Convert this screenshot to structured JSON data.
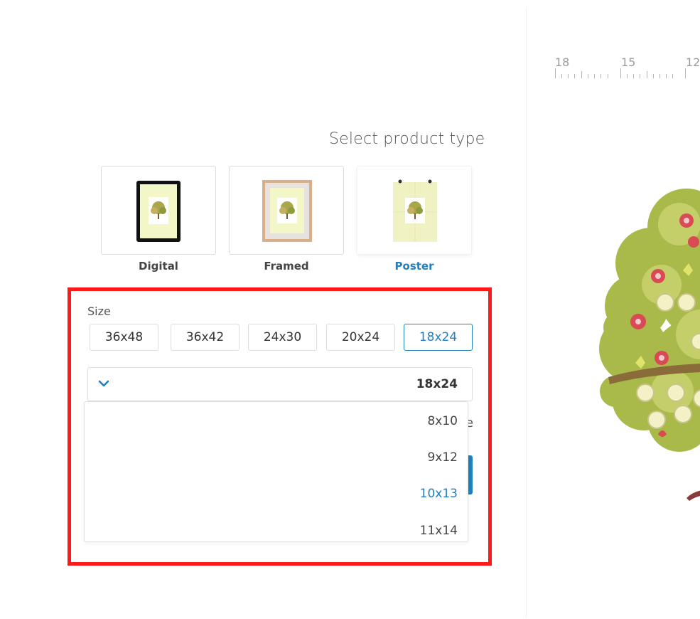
{
  "preview": {
    "ruler_labels": [
      "18",
      "15",
      "12"
    ]
  },
  "product_type": {
    "title": "Select product type",
    "options": [
      {
        "label": "Digital",
        "icon": "tablet-icon",
        "selected": false
      },
      {
        "label": "Framed",
        "icon": "framed-print-icon",
        "selected": false
      },
      {
        "label": "Poster",
        "icon": "poster-icon",
        "selected": true
      }
    ]
  },
  "size": {
    "label": "Size",
    "buttons": [
      {
        "label": "36x48",
        "selected": false
      },
      {
        "label": "36x42",
        "selected": false
      },
      {
        "label": "24x30",
        "selected": false
      },
      {
        "label": "20x24",
        "selected": false
      },
      {
        "label": "18x24",
        "selected": true
      }
    ],
    "select_value": "18x24",
    "dropdown_options": [
      {
        "label": "8x10",
        "highlighted": false
      },
      {
        "label": "9x12",
        "highlighted": false
      },
      {
        "label": "10x13",
        "highlighted": true
      },
      {
        "label": "11x14",
        "highlighted": false
      }
    ]
  },
  "obscured_text": "e",
  "colors": {
    "accent": "#1f7fc0",
    "highlight_border": "#ff1a1a",
    "tree_green": "#a9b94a",
    "flower_red": "#d94a55"
  }
}
